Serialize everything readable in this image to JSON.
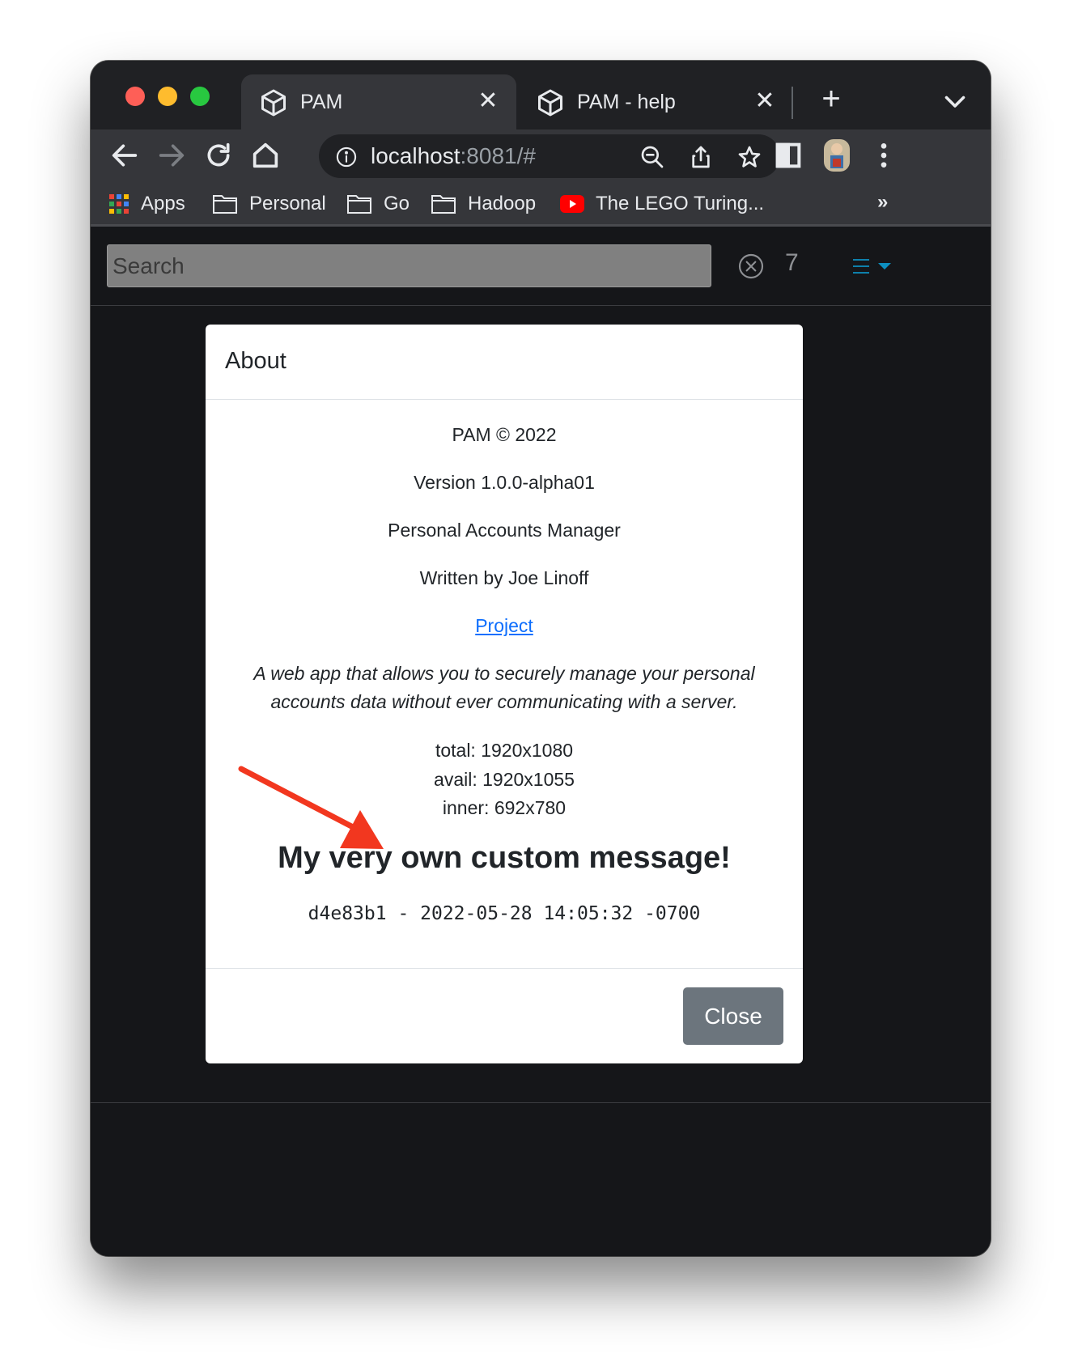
{
  "browser": {
    "tabs": [
      {
        "title": "PAM",
        "active": true,
        "icon": "cube-icon"
      },
      {
        "title": "PAM - help",
        "active": false,
        "icon": "cube-icon"
      }
    ],
    "close_glyph": "✕",
    "new_tab_glyph": "+",
    "url_host": "localhost",
    "url_rest": ":8081/#",
    "bookmarks": [
      {
        "label": "Apps",
        "icon": "apps-grid-icon"
      },
      {
        "label": "Personal",
        "icon": "folder-icon"
      },
      {
        "label": "Go",
        "icon": "folder-icon"
      },
      {
        "label": "Hadoop",
        "icon": "folder-icon"
      },
      {
        "label": "The LEGO Turing...",
        "icon": "youtube-icon"
      }
    ],
    "more_bookmarks": "»"
  },
  "app": {
    "search_placeholder": "Search",
    "count": "7",
    "accent_color": "#0d8fc0"
  },
  "about": {
    "title": "About",
    "copyright": "PAM © 2022",
    "version": "Version 1.0.0-alpha01",
    "name": "Personal Accounts Manager",
    "author": "Written by Joe Linoff",
    "project_link": "Project",
    "description_line1": "A web app that allows you to securely manage your personal",
    "description_line2": "accounts data without ever communicating with a server.",
    "total": "total: 1920x1080",
    "avail": "avail: 1920x1055",
    "inner": "inner: 692x780",
    "custom_message": "My very own custom message!",
    "build": "d4e83b1 - 2022-05-28 14:05:32 -0700",
    "close_label": "Close",
    "arrow_color": "#f2371f"
  }
}
